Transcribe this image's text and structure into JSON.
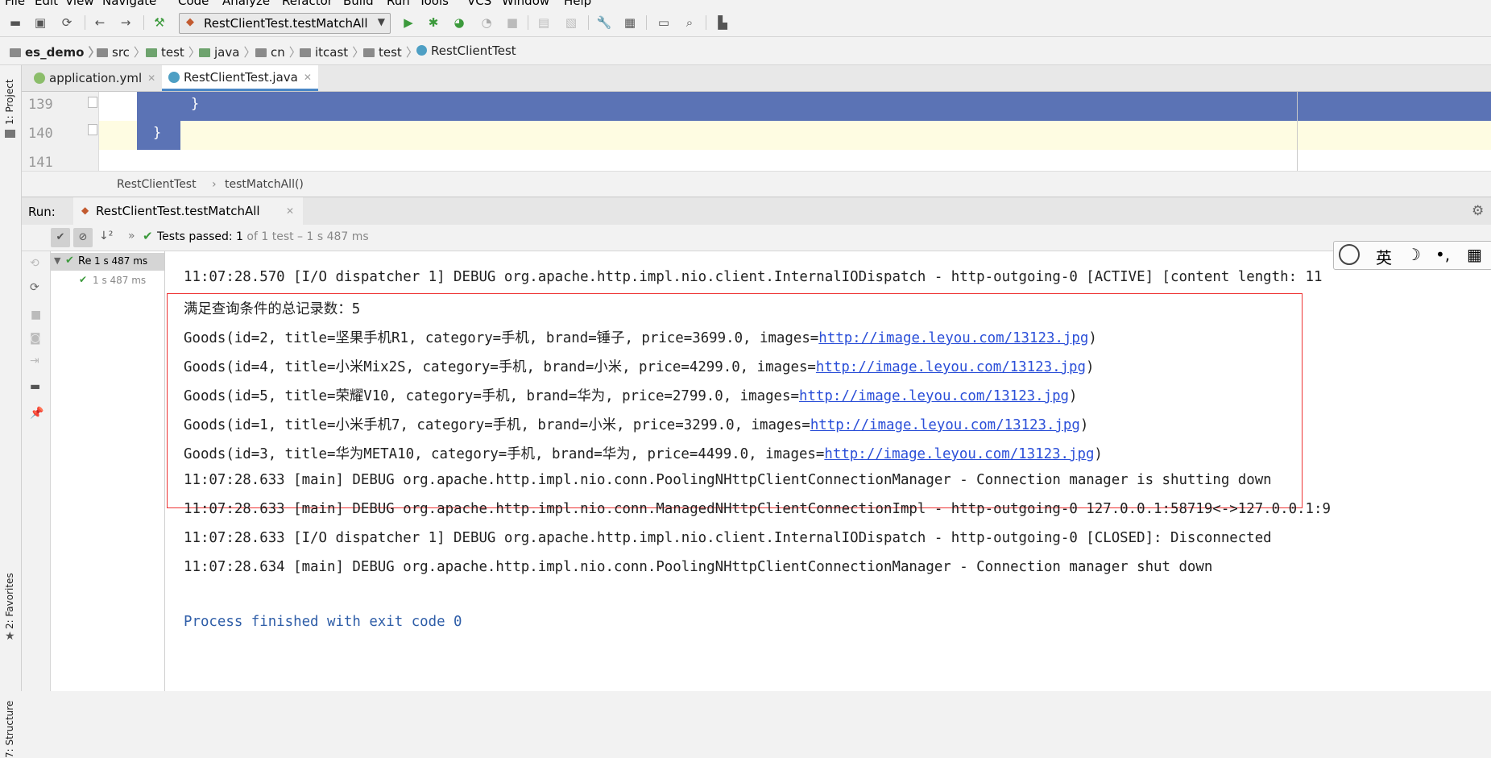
{
  "menu": [
    "File",
    "Edit",
    "View",
    "Navigate",
    "Code",
    "Analyze",
    "Refactor",
    "Build",
    "Run",
    "Tools",
    "VCS",
    "Window",
    "Help"
  ],
  "toolbar": {
    "run_config": "RestClientTest.testMatchAll",
    "icons": [
      "open-icon",
      "save-icon",
      "sync-icon",
      "back-icon",
      "forward-icon",
      "build-icon",
      "run-icon",
      "debug-icon",
      "coverage-icon",
      "profile-icon",
      "stop-icon",
      "attach-icon",
      "sdk-icon",
      "settings-icon",
      "project-structure-icon",
      "terminal-icon",
      "search-icon",
      "vcs-icon"
    ]
  },
  "breadcrumb": [
    "es_demo",
    "src",
    "test",
    "java",
    "cn",
    "itcast",
    "test",
    "RestClientTest"
  ],
  "left_strip": {
    "project": "1: Project",
    "favorites": "2: Favorites",
    "structure": "7: Structure"
  },
  "tabs": [
    {
      "label": "application.yml",
      "active": false
    },
    {
      "label": "RestClientTest.java",
      "active": true
    }
  ],
  "editor": {
    "lines": [
      {
        "number": "139",
        "code": "}"
      },
      {
        "number": "140",
        "code": "}"
      },
      {
        "number": "141",
        "code": ""
      }
    ],
    "breadcrumb": {
      "class": "RestClientTest",
      "method": "testMatchAll()"
    }
  },
  "run": {
    "label": "Run:",
    "tab": "RestClientTest.testMatchAll",
    "status_prefix": "Tests passed:",
    "status_count": "1",
    "status_suffix": "of 1 test – 1 s 487 ms",
    "tree": [
      {
        "name": "Re",
        "time": "1 s 487 ms"
      },
      {
        "name": "",
        "time": "1 s 487 ms"
      }
    ]
  },
  "console": {
    "lines": [
      "11:07:28.570 [I/O dispatcher 1] DEBUG org.apache.http.impl.nio.client.InternalIODispatch - http-outgoing-0 [ACTIVE] [content length: 11",
      "满足查询条件的总记录数：5",
      "Goods(id=2, title=坚果手机R1, category=手机, brand=锤子, price=3699.0, images=",
      "Goods(id=4, title=小米Mix2S, category=手机, brand=小米, price=4299.0, images=",
      "Goods(id=5, title=荣耀V10, category=手机, brand=华为, price=2799.0, images=",
      "Goods(id=1, title=小米手机7, category=手机, brand=小米, price=3299.0, images=",
      "Goods(id=3, title=华为META10, category=手机, brand=华为, price=4499.0, images=",
      "11:07:28.633 [main] DEBUG org.apache.http.impl.nio.conn.PoolingNHttpClientConnectionManager - Connection manager is shutting down",
      "11:07:28.633 [main] DEBUG org.apache.http.impl.nio.conn.ManagedNHttpClientConnectionImpl - http-outgoing-0 127.0.0.1:58719<->127.0.0.1:9",
      "11:07:28.633 [I/O dispatcher 1] DEBUG org.apache.http.impl.nio.client.InternalIODispatch - http-outgoing-0 [CLOSED]: Disconnected",
      "11:07:28.634 [main] DEBUG org.apache.http.impl.nio.conn.PoolingNHttpClientConnectionManager - Connection manager shut down",
      "Process finished with exit code 0"
    ],
    "image_url": "http://image.leyou.com/13123.jpg",
    "close_paren": ")"
  },
  "ime": {
    "lang": "英",
    "moon": "☽",
    "dots": "•,",
    "grid": "▦"
  },
  "colors": {
    "selection": "#5b73b5",
    "current_line": "#fefce2",
    "link": "#2b4fd8",
    "highlight_box": "#e33333",
    "pass_green": "#3c9a3c"
  }
}
